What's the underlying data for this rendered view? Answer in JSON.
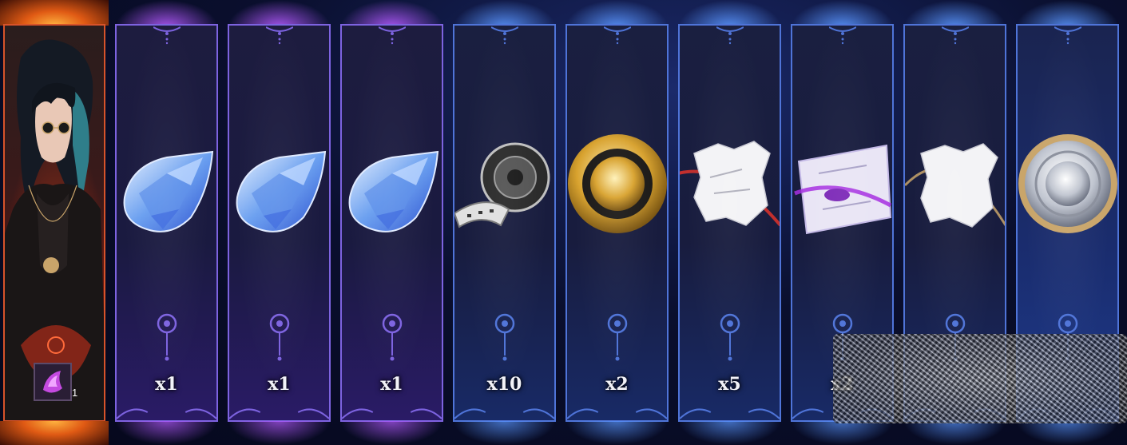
{
  "character_card": {
    "badge_count": "1",
    "badge_icon": "purple-crystal-shard-icon",
    "theme_color": "#d7532a"
  },
  "reward_cards": [
    {
      "item": "blue-gem-icon",
      "quantity": "x1",
      "theme": "purple"
    },
    {
      "item": "blue-gem-icon",
      "quantity": "x1",
      "theme": "purple"
    },
    {
      "item": "blue-gem-icon",
      "quantity": "x1",
      "theme": "purple"
    },
    {
      "item": "film-reel-icon",
      "quantity": "x10",
      "theme": "blue"
    },
    {
      "item": "gold-coin-icon",
      "quantity": "x2",
      "theme": "blue"
    },
    {
      "item": "torn-paper-red-icon",
      "quantity": "x5",
      "theme": "blue"
    },
    {
      "item": "scroll-purple-icon",
      "quantity": "x2",
      "theme": "blue"
    },
    {
      "item": "torn-paper-gold-icon",
      "quantity": "",
      "theme": "blue"
    },
    {
      "item": "silver-coin-icon",
      "quantity": "",
      "theme": "blue"
    }
  ],
  "colors": {
    "purple_accent": "#7d63e0",
    "blue_accent": "#4f74d8",
    "fire_accent": "#e05a14"
  }
}
